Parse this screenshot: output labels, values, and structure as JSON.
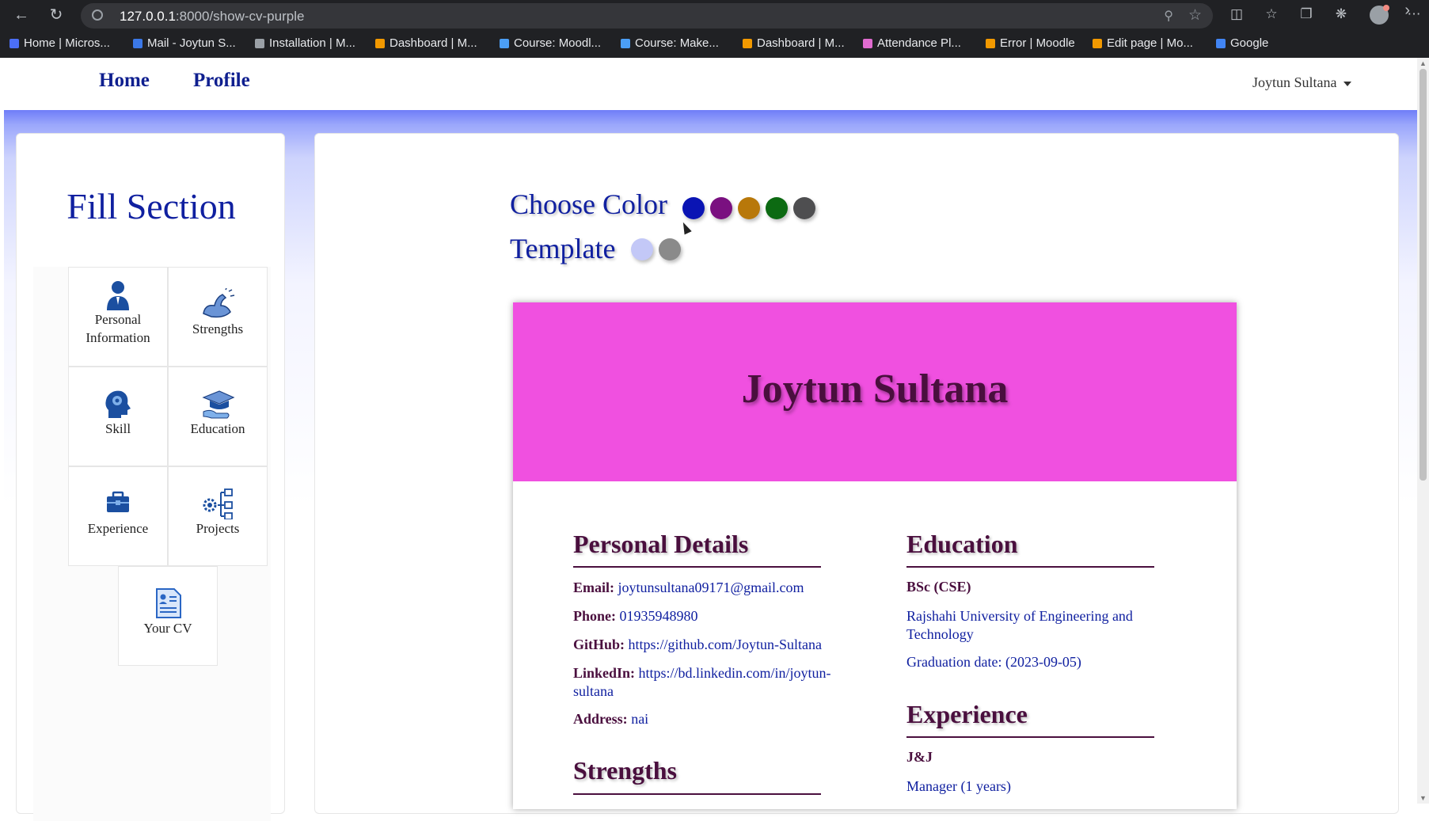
{
  "browser": {
    "url_host": "127.0.0.1",
    "url_rest": ":8000/show-cv-purple",
    "bookmarks": [
      {
        "label": "Home | Micros...",
        "color": "#4b6ef5"
      },
      {
        "label": "Mail - Joytun S...",
        "color": "#3b78e7"
      },
      {
        "label": "Installation | M...",
        "color": "#9aa0a6"
      },
      {
        "label": "Dashboard | M...",
        "color": "#f29900"
      },
      {
        "label": "Course: Moodl...",
        "color": "#4b9ef5"
      },
      {
        "label": "Course: Make...",
        "color": "#4b9ef5"
      },
      {
        "label": "Dashboard | M...",
        "color": "#f29900"
      },
      {
        "label": "Attendance Pl...",
        "color": "#e06bd0"
      },
      {
        "label": "Error | Moodle",
        "color": "#f29900"
      },
      {
        "label": "Edit page | Mo...",
        "color": "#f29900"
      },
      {
        "label": "Google",
        "color": "#4285f4"
      }
    ]
  },
  "nav": {
    "home": "Home",
    "profile": "Profile",
    "user": "Joytun Sultana"
  },
  "sidebar": {
    "title": "Fill Section",
    "items": [
      {
        "label": "Personal Information",
        "icon": "person-icon"
      },
      {
        "label": "Strengths",
        "icon": "muscle-arm-icon"
      },
      {
        "label": "Skill",
        "icon": "brain-head-icon"
      },
      {
        "label": "Education",
        "icon": "graduation-cap-icon"
      },
      {
        "label": "Experience",
        "icon": "briefcase-icon"
      },
      {
        "label": "Projects",
        "icon": "gear-checklist-icon"
      },
      {
        "label": "Your CV",
        "icon": "cv-document-icon"
      }
    ]
  },
  "controls": {
    "choose_color": "Choose Color",
    "template": "Template",
    "colors": [
      "#0a14b4",
      "#7a1080",
      "#b8780a",
      "#0c6a12",
      "#4e4e50"
    ],
    "templates": [
      "#c3c8f7",
      "#8a8a8a"
    ]
  },
  "cv": {
    "name": "Joytun Sultana",
    "header_color": "#f050e0",
    "personal": {
      "heading": "Personal Details",
      "email_label": "Email:",
      "email": "joytunsultana09171@gmail.com",
      "phone_label": "Phone:",
      "phone": "01935948980",
      "github_label": "GitHub:",
      "github": "https://github.com/Joytun-Sultana",
      "linkedin_label": "LinkedIn:",
      "linkedin": "https://bd.linkedin.com/in/joytun-sultana",
      "address_label": "Address:",
      "address": "nai"
    },
    "strengths": {
      "heading": "Strengths"
    },
    "education": {
      "heading": "Education",
      "degree": "BSc (CSE)",
      "institution": "Rajshahi University of Engineering and Technology",
      "graduation": "Graduation date: (2023-09-05)"
    },
    "experience": {
      "heading": "Experience",
      "company": "J&J",
      "role": "Manager (1 years)"
    }
  }
}
